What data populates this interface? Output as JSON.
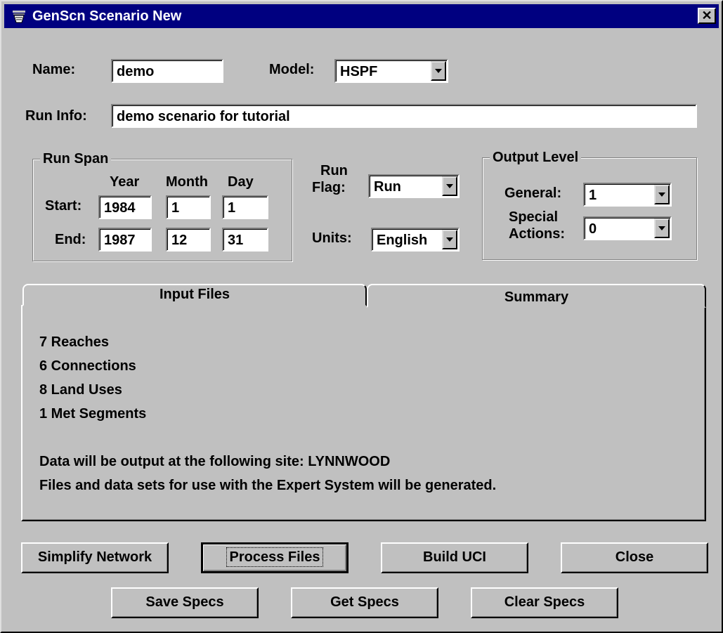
{
  "window": {
    "title": "GenScn Scenario New",
    "close_glyph": "✕"
  },
  "name": {
    "label": "Name:",
    "value": "demo"
  },
  "model": {
    "label": "Model:",
    "value": "HSPF"
  },
  "run_info": {
    "label": "Run Info:",
    "value": "demo scenario for tutorial"
  },
  "run_span": {
    "title": "Run Span",
    "year_label": "Year",
    "month_label": "Month",
    "day_label": "Day",
    "start_label": "Start:",
    "end_label": "End:",
    "start": {
      "year": "1984",
      "month": "1",
      "day": "1"
    },
    "end": {
      "year": "1987",
      "month": "12",
      "day": "31"
    }
  },
  "run_flag": {
    "label_line1": "Run",
    "label_line2": "Flag:",
    "value": "Run"
  },
  "units": {
    "label": "Units:",
    "value": "English"
  },
  "output_level": {
    "title": "Output Level",
    "general_label": "General:",
    "general_value": "1",
    "special_label_line1": "Special",
    "special_label_line2": "Actions:",
    "special_value": "0"
  },
  "tabs": {
    "input_files": "Input Files",
    "summary": "Summary"
  },
  "summary": {
    "lines": [
      "7 Reaches",
      "6 Connections",
      "8 Land Uses",
      "1 Met Segments",
      "",
      "Data will be output at the following site: LYNNWOOD",
      "Files and data sets for use with the Expert System will be generated."
    ]
  },
  "buttons": {
    "simplify_network": "Simplify Network",
    "process_files": "Process Files",
    "build_uci": "Build UCI",
    "close": "Close",
    "save_specs": "Save Specs",
    "get_specs": "Get Specs",
    "clear_specs": "Clear Specs"
  }
}
